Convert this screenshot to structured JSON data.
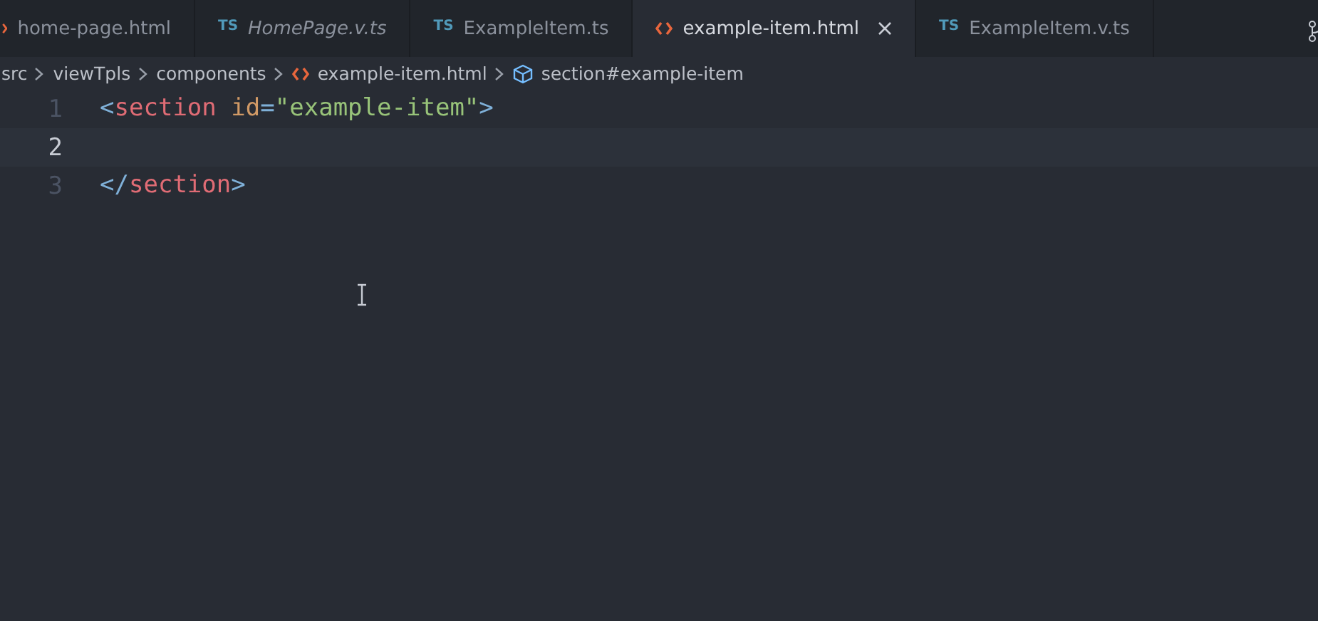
{
  "tabs": [
    {
      "label": "home-page.html",
      "kind": "html",
      "italic": false,
      "selected": false
    },
    {
      "label": "HomePage.v.ts",
      "kind": "ts",
      "badge": "TS",
      "italic": true,
      "selected": false
    },
    {
      "label": "ExampleItem.ts",
      "kind": "ts",
      "badge": "TS",
      "italic": false,
      "selected": false
    },
    {
      "label": "example-item.html",
      "kind": "html",
      "italic": false,
      "selected": true
    },
    {
      "label": "ExampleItem.v.ts",
      "kind": "ts",
      "badge": "TS",
      "italic": false,
      "selected": false
    }
  ],
  "breadcrumbs": [
    {
      "label": "src",
      "kind": "folder"
    },
    {
      "label": "viewTpls",
      "kind": "folder"
    },
    {
      "label": "components",
      "kind": "folder"
    },
    {
      "label": "example-item.html",
      "kind": "html"
    },
    {
      "label": "section#example-item",
      "kind": "symbol"
    }
  ],
  "editor": {
    "lines": [
      {
        "number": "1",
        "current": false,
        "tokens": [
          {
            "text": "<",
            "kind": "punct"
          },
          {
            "text": "section",
            "kind": "tag"
          },
          {
            "text": "id",
            "kind": "attr"
          },
          {
            "text": "=",
            "kind": "punct"
          },
          {
            "text": "\"example-item\"",
            "kind": "string"
          },
          {
            "text": ">",
            "kind": "punct"
          }
        ]
      },
      {
        "number": "2",
        "current": true
      },
      {
        "number": "3",
        "current": false,
        "tokens": [
          {
            "text": "</",
            "kind": "punct"
          },
          {
            "text": "section",
            "kind": "tag"
          },
          {
            "text": ">",
            "kind": "punct"
          }
        ]
      }
    ]
  }
}
